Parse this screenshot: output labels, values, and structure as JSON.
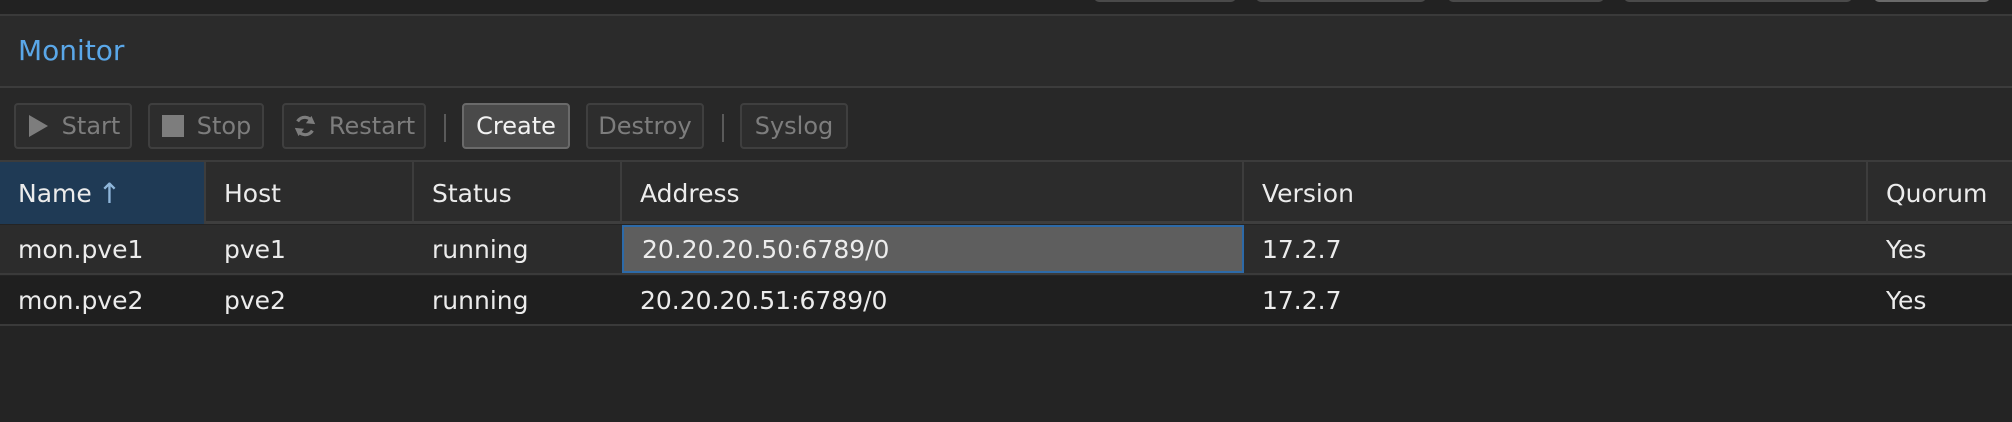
{
  "panel": {
    "title": "Monitor"
  },
  "toolbar": {
    "start_label": "Start",
    "stop_label": "Stop",
    "restart_label": "Restart",
    "create_label": "Create",
    "destroy_label": "Destroy",
    "syslog_label": "Syslog"
  },
  "grid": {
    "columns": [
      "Name",
      "Host",
      "Status",
      "Address",
      "Version",
      "Quorum"
    ],
    "sort": {
      "column": "Name",
      "direction": "ascending"
    },
    "rows": [
      [
        "mon.pve1",
        "pve1",
        "running",
        "20.20.20.50:6789/0",
        "17.2.7",
        "Yes"
      ],
      [
        "mon.pve2",
        "pve2",
        "running",
        "20.20.20.51:6789/0",
        "17.2.7",
        "Yes"
      ]
    ],
    "selected_row": 0,
    "focused_cell": "Address"
  },
  "icons": {
    "start": "play-icon",
    "stop": "stop-square-icon",
    "restart": "refresh-icon",
    "sort": "arrow-up-icon"
  },
  "colors": {
    "accent_title": "#5aa7e8",
    "sorted_header": "#1f3a55",
    "focus_border": "#2d6aa8",
    "background": "#242424"
  }
}
